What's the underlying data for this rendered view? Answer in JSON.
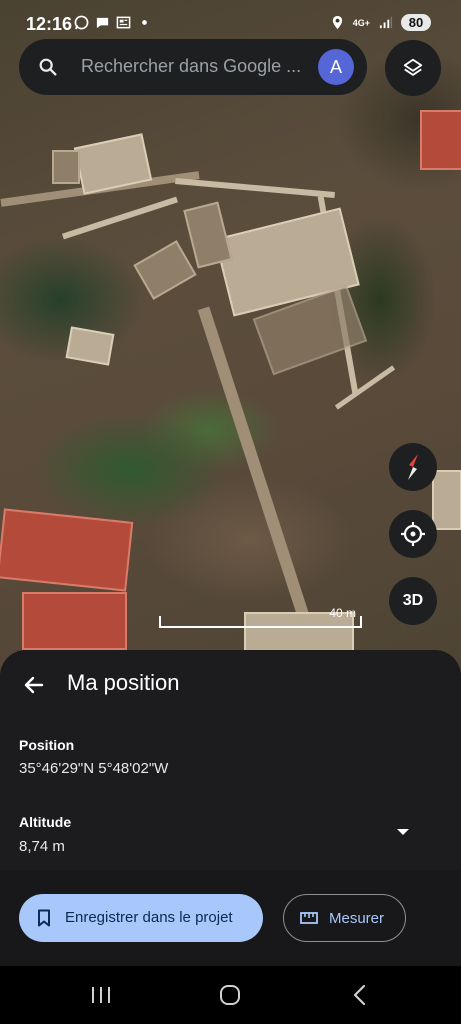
{
  "status_bar": {
    "time": "12:16",
    "network": "4G+",
    "battery": "80"
  },
  "search": {
    "placeholder": "Rechercher dans Google ...",
    "avatar_letter": "A"
  },
  "map": {
    "scale_label": "40 m",
    "three_d_label": "3D"
  },
  "sheet": {
    "title": "Ma position",
    "position_label": "Position",
    "position_value": "35°46'29\"N 5°48'02\"W",
    "altitude_label": "Altitude",
    "altitude_value": "8,74 m",
    "save_label": "Enregistrer dans le projet",
    "measure_label": "Mesurer"
  },
  "colors": {
    "accent": "#a8c7fa",
    "sheet_bg": "#1c1c1e",
    "avatar_bg": "#5566d6"
  },
  "icons": [
    "search-icon",
    "layers-icon",
    "compass-icon",
    "my-location-icon",
    "arrow-back-icon",
    "chevron-down-icon",
    "bookmark-icon",
    "ruler-icon"
  ]
}
